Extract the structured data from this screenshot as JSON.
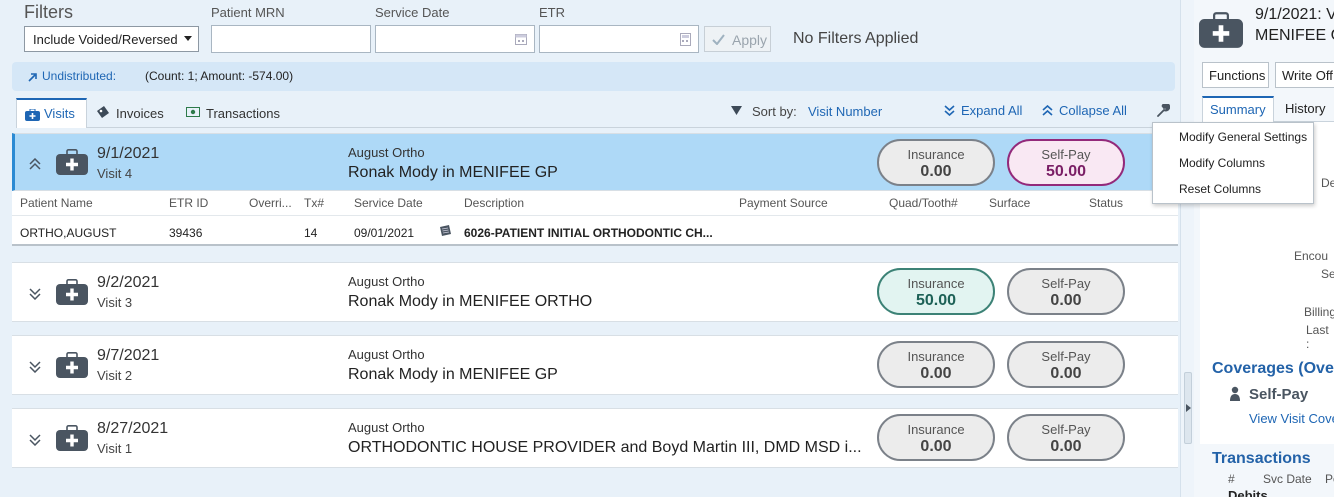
{
  "filters": {
    "title": "Filters",
    "voided_select": "Include Voided/Reversed",
    "mrn_label": "Patient MRN",
    "mrn_value": "",
    "service_date_label": "Service Date",
    "service_date_value": "",
    "etr_label": "ETR",
    "etr_value": "",
    "apply_label": "Apply",
    "status_text": "No Filters Applied"
  },
  "undistributed": {
    "link": "Undistributed:",
    "summary": "(Count: 1; Amount: -574.00)"
  },
  "tabs": [
    {
      "label": "Visits"
    },
    {
      "label": "Invoices"
    },
    {
      "label": "Transactions"
    }
  ],
  "toolbar": {
    "sort_label": "Sort by:",
    "sort_value": "Visit Number",
    "expand_all": "Expand All",
    "collapse_all": "Collapse All"
  },
  "visits": [
    {
      "date": "9/1/2021",
      "visit": "Visit 4",
      "practice": "August Ortho",
      "provider": "Ronak Mody in MENIFEE GP",
      "insurance_label": "Insurance",
      "insurance": "0.00",
      "selfpay_label": "Self-Pay",
      "selfpay": "50.00"
    },
    {
      "date": "9/2/2021",
      "visit": "Visit 3",
      "practice": "August Ortho",
      "provider": "Ronak Mody in MENIFEE ORTHO",
      "insurance_label": "Insurance",
      "insurance": "50.00",
      "selfpay_label": "Self-Pay",
      "selfpay": "0.00"
    },
    {
      "date": "9/7/2021",
      "visit": "Visit 2",
      "practice": "August Ortho",
      "provider": "Ronak Mody in MENIFEE GP",
      "insurance_label": "Insurance",
      "insurance": "0.00",
      "selfpay_label": "Self-Pay",
      "selfpay": "0.00"
    },
    {
      "date": "8/27/2021",
      "visit": "Visit 1",
      "practice": "August Ortho",
      "provider": "ORTHODONTIC HOUSE PROVIDER and Boyd Martin III, DMD MSD i...",
      "insurance_label": "Insurance",
      "insurance": "0.00",
      "selfpay_label": "Self-Pay",
      "selfpay": "0.00"
    }
  ],
  "detail_table": {
    "headers": [
      "Patient Name",
      "ETR ID",
      "Overri...",
      "Tx#",
      "Service Date",
      "Description",
      "Payment Source",
      "Quad/Tooth#",
      "Surface",
      "Status"
    ],
    "row": {
      "patient": "ORTHO,AUGUST",
      "etr": "39436",
      "override": "",
      "tx": "14",
      "service_date": "09/01/2021",
      "description": "6026-PATIENT INITIAL ORTHODONTIC CH...",
      "payment_source": "",
      "quad": "",
      "surface": "",
      "status": ""
    }
  },
  "context_menu": [
    "Modify General Settings",
    "Modify Columns",
    "Reset Columns"
  ],
  "right_panel": {
    "title_line1": "9/1/2021: V",
    "title_line2": "MENIFEE G",
    "functions_button": "Functions",
    "writeoff_button": "Write Off",
    "tabs": [
      "Summary",
      "History"
    ],
    "field_labels": [
      "De",
      "Encou",
      "Se",
      "Billing",
      "Last :"
    ],
    "coverages_heading": "Coverages (Over",
    "selfpay_label": "Self-Pay",
    "view_link": "View Visit Cove",
    "transactions_heading": "Transactions",
    "tx_columns": [
      "#",
      "Svc Date",
      "Po"
    ],
    "debits_label": "Debits"
  },
  "colors": {
    "accent": "#1e66b4",
    "selected_row": "#aed9f7",
    "insurance_green": "#3c8276",
    "selfpay_purple": "#93297a"
  }
}
